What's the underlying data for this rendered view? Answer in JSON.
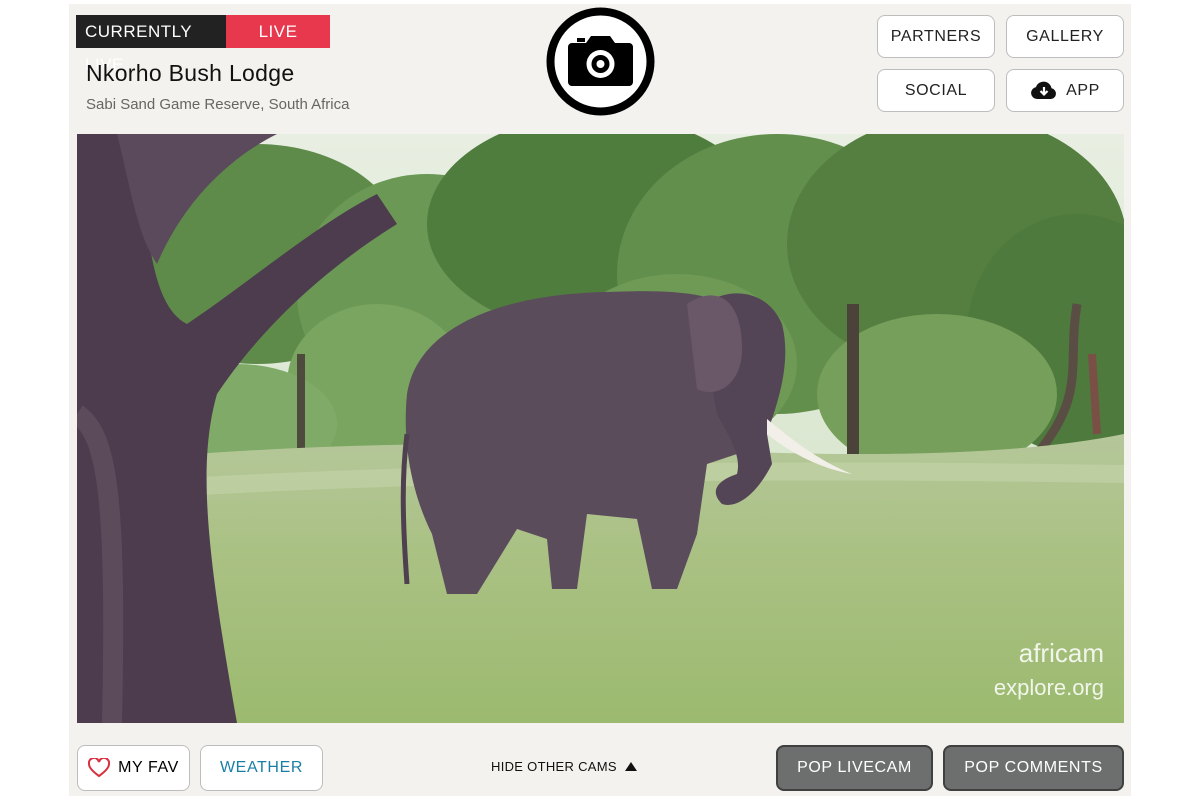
{
  "header": {
    "live_status_label": "CURRENTLY LIVE",
    "live_badge": "LIVE",
    "title": "Nkorho Bush Lodge",
    "subtitle": "Sabi Sand Game Reserve, South Africa"
  },
  "nav": {
    "partners": "PARTNERS",
    "gallery": "GALLERY",
    "social": "SOCIAL",
    "app": "APP"
  },
  "video": {
    "watermark_line1": "africam",
    "watermark_line2": "explore.org"
  },
  "footer": {
    "my_fav": "MY FAV",
    "weather": "WEATHER",
    "hide_other_cams": "HIDE OTHER CAMS",
    "pop_livecam": "POP LIVECAM",
    "pop_comments": "POP COMMENTS"
  },
  "colors": {
    "live_red": "#e8384d",
    "weather_blue": "#1a7fa6",
    "heart_red": "#d9303f",
    "dark_button": "#6d6f6f"
  },
  "icons": [
    "camera-logo-icon",
    "cloud-download-icon",
    "heart-icon",
    "triangle-up-icon"
  ]
}
